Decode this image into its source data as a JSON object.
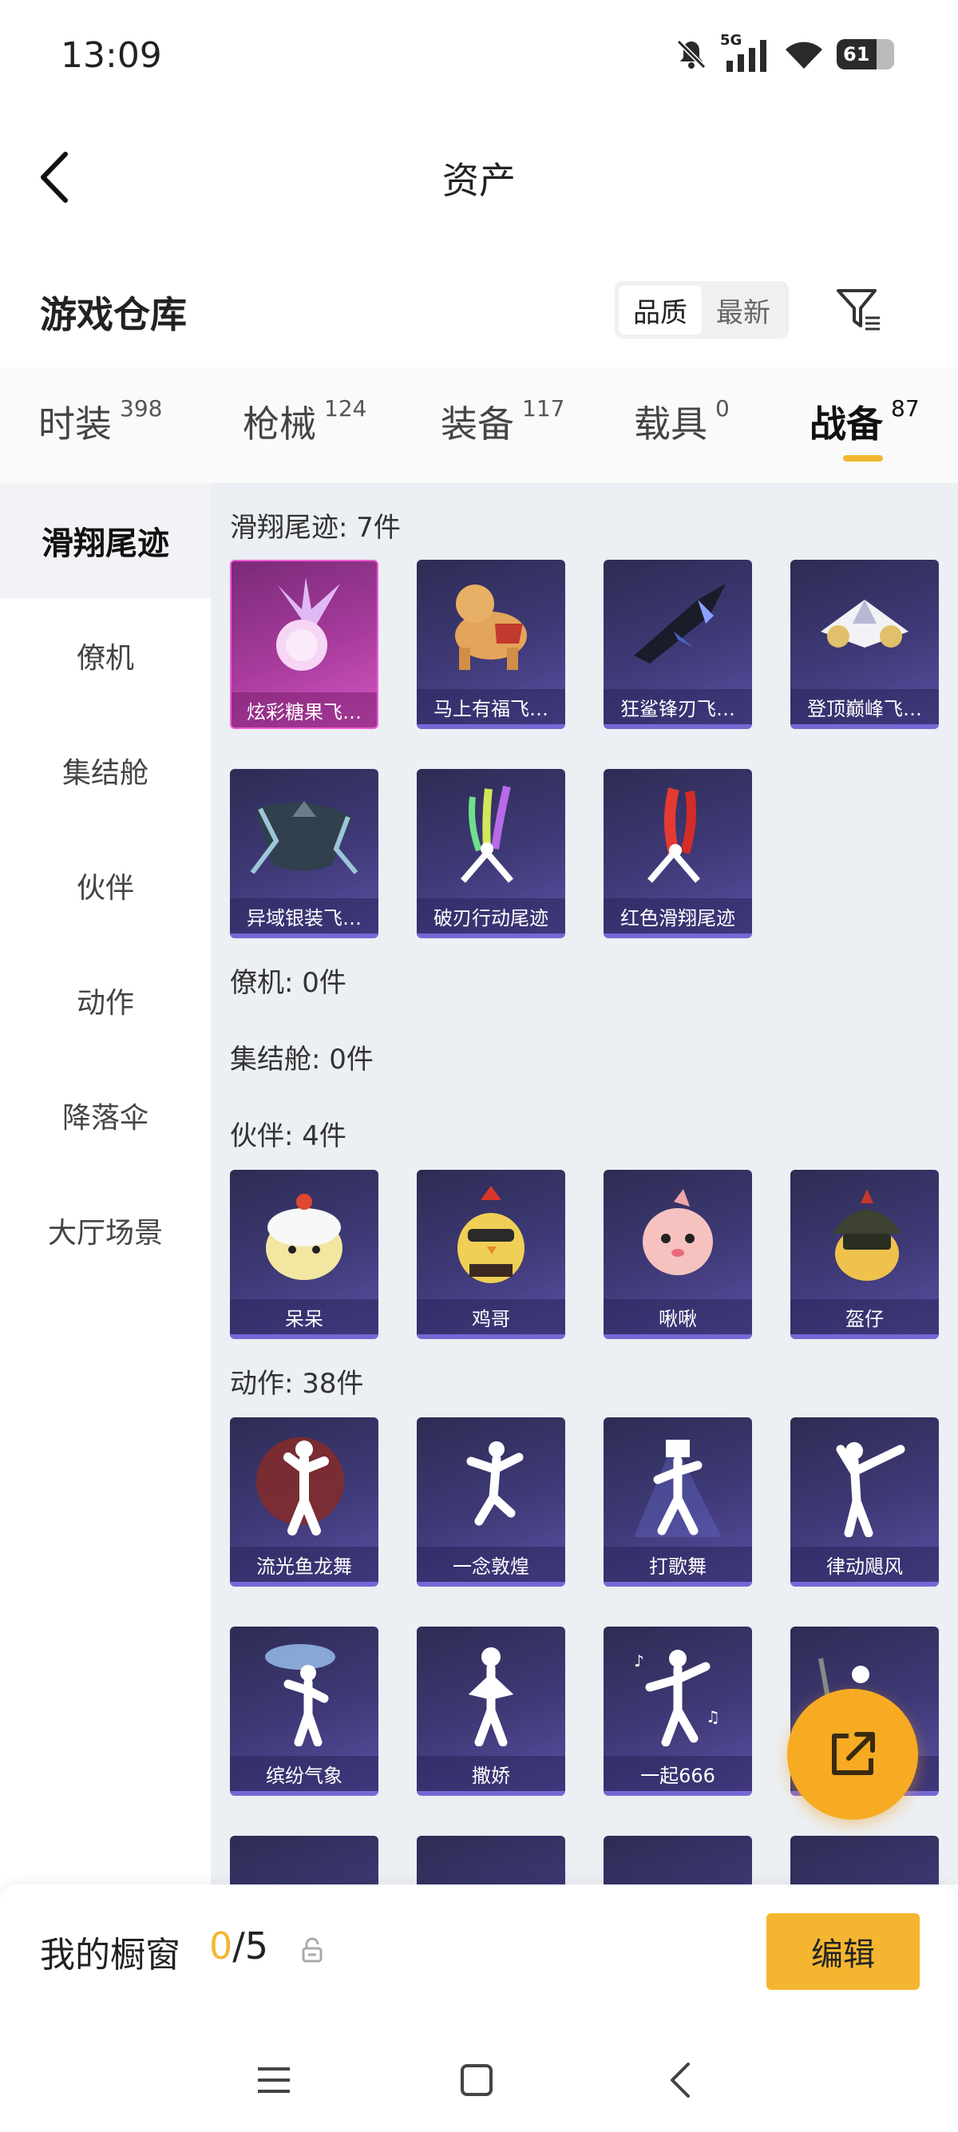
{
  "status_bar": {
    "time": "13:09",
    "network": "5G",
    "battery": "61"
  },
  "header": {
    "title": "资产"
  },
  "warehouse": {
    "title": "游戏仓库",
    "sort_options": [
      "品质",
      "最新"
    ]
  },
  "tabs": [
    {
      "label": "时装",
      "count": "398"
    },
    {
      "label": "枪械",
      "count": "124"
    },
    {
      "label": "装备",
      "count": "117"
    },
    {
      "label": "载具",
      "count": "0"
    },
    {
      "label": "战备",
      "count": "87"
    }
  ],
  "sidebar": {
    "items": [
      {
        "label": "滑翔尾迹"
      },
      {
        "label": "僚机"
      },
      {
        "label": "集结舱"
      },
      {
        "label": "伙伴"
      },
      {
        "label": "动作"
      },
      {
        "label": "降落伞"
      },
      {
        "label": "大厅场景"
      }
    ]
  },
  "sections": {
    "glide": {
      "title": "滑翔尾迹: 7件",
      "items": [
        "炫彩糖果飞…",
        "马上有福飞…",
        "狂鲨锋刃飞…",
        "登顶巅峰飞…",
        "异域银装飞…",
        "破刃行动尾迹",
        "红色滑翔尾迹"
      ]
    },
    "wingman": {
      "title": "僚机: 0件"
    },
    "capsule": {
      "title": "集结舱: 0件"
    },
    "partner": {
      "title": "伙伴: 4件",
      "items": [
        "呆呆",
        "鸡哥",
        "啾啾",
        "盔仔"
      ]
    },
    "emote": {
      "title": "动作: 38件",
      "items": [
        "流光鱼龙舞",
        "一念敦煌",
        "打歌舞",
        "律动飓风",
        "缤纷气象",
        "撒娇",
        "一起666",
        ""
      ]
    }
  },
  "showcase": {
    "label": "我的橱窗",
    "current": "0",
    "separator": "/",
    "max": "5",
    "edit_label": "编辑"
  },
  "colors": {
    "accent": "#f4b630",
    "card_purple": "#3f3a78",
    "card_pink": "#a83c9d"
  }
}
